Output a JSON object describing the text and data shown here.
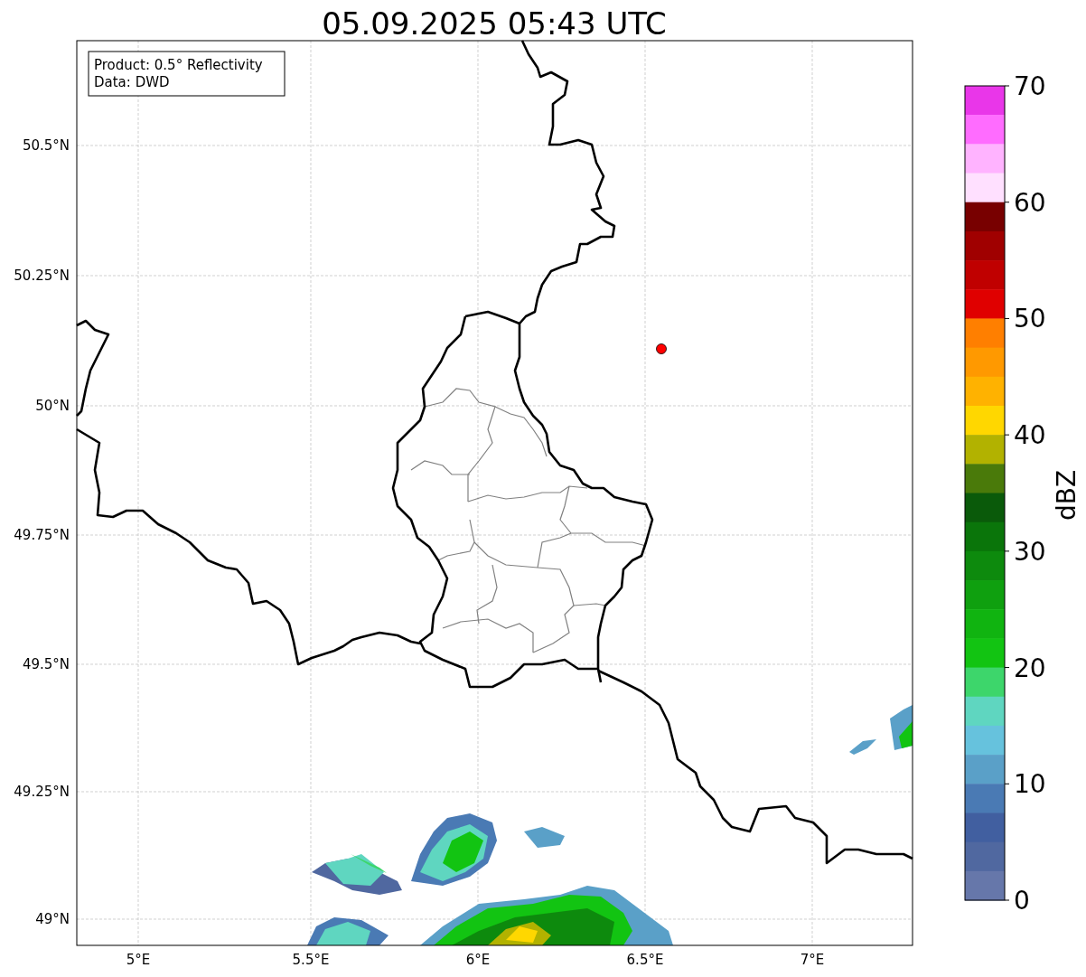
{
  "title": "05.09.2025 05:43 UTC",
  "info_box": [
    "Product: 0.5° Reflectivity",
    "Data: DWD"
  ],
  "lat_ticks": [
    "50.5°N",
    "50.25°N",
    "50°N",
    "49.75°N",
    "49.5°N",
    "49.25°N",
    "49°N"
  ],
  "lon_ticks": [
    "5°E",
    "5.5°E",
    "6°E",
    "6.5°E",
    "7°E"
  ],
  "colorbar": {
    "label": "dBZ",
    "ticks": [
      "70",
      "60",
      "50",
      "40",
      "30",
      "20",
      "10",
      "0"
    ],
    "segments": [
      {
        "color": "#e936e9"
      },
      {
        "color": "#ff6cff"
      },
      {
        "color": "#ffb3ff"
      },
      {
        "color": "#ffe0ff"
      },
      {
        "color": "#780000"
      },
      {
        "color": "#a00000"
      },
      {
        "color": "#c00000"
      },
      {
        "color": "#e00000"
      },
      {
        "color": "#ff7f00"
      },
      {
        "color": "#ff9900"
      },
      {
        "color": "#ffb200"
      },
      {
        "color": "#ffd700"
      },
      {
        "color": "#b2b200"
      },
      {
        "color": "#4a7a0a"
      },
      {
        "color": "#0a5a0a"
      },
      {
        "color": "#0a750a"
      },
      {
        "color": "#0d8a0d"
      },
      {
        "color": "#0fa00f"
      },
      {
        "color": "#10b410"
      },
      {
        "color": "#12c412"
      },
      {
        "color": "#3dd66b"
      },
      {
        "color": "#5fd6c0"
      },
      {
        "color": "#66c2dd"
      },
      {
        "color": "#5aa0c8"
      },
      {
        "color": "#4a7ab4"
      },
      {
        "color": "#415fa0"
      },
      {
        "color": "#5068a0"
      },
      {
        "color": "#6677aa"
      }
    ]
  }
}
